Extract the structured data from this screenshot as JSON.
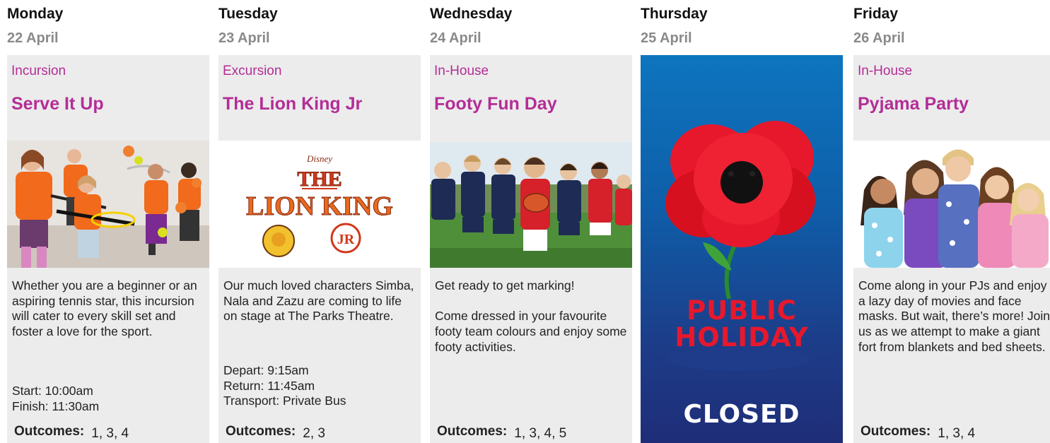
{
  "days": [
    {
      "day": "Monday",
      "date": "22 April",
      "type": "Incursion",
      "title": "Serve It Up",
      "image_icon": "tennis-kids-photo",
      "description": "Whether you are a beginner or an aspiring tennis star, this incursion will cater to every skill set and foster a love for the sport.",
      "times": "Start: 10:00am\nFinish: 11:30am",
      "outcomes_label": "Outcomes:",
      "outcomes": "1, 3, 4"
    },
    {
      "day": "Tuesday",
      "date": "23 April",
      "type": "Excursion",
      "title": "The Lion King Jr",
      "image_icon": "lion-king-jr-logo",
      "logo_text": {
        "brand": "Disney",
        "line1": "THE",
        "line2": "LION KING",
        "badge": "JR"
      },
      "description": "Our much loved characters Simba, Nala and Zazu are coming to life on stage at The Parks Theatre.",
      "times": "Depart: 9:15am\nReturn: 11:45am\nTransport: Private Bus",
      "outcomes_label": "Outcomes:",
      "outcomes": "2, 3"
    },
    {
      "day": "Wednesday",
      "date": "24 April",
      "type": "In-House",
      "title": "Footy Fun Day",
      "image_icon": "footy-kids-photo",
      "description": "Get ready to get marking!\n\nCome dressed in your favourite footy team colours and enjoy some footy activities.",
      "outcomes_label": "Outcomes:",
      "outcomes": "1, 3, 4, 5"
    },
    {
      "day": "Thursday",
      "date": "25 April",
      "holiday_line1": "PUBLIC",
      "holiday_line2": "HOLIDAY",
      "closed": "CLOSED",
      "image_icon": "poppy-icon"
    },
    {
      "day": "Friday",
      "date": "26 April",
      "type": "In-House",
      "title": "Pyjama Party",
      "image_icon": "pyjama-kids-photo",
      "description": "Come along in your PJs and enjoy a lazy day of movies and face masks. But wait, there’s more! Join us as we attempt to make a giant fort from blankets and bed sheets.",
      "outcomes_label": "Outcomes:",
      "outcomes": "1, 3, 4"
    }
  ],
  "colors": {
    "accent": "#b32d96",
    "date_grey": "#8a8a8a",
    "card_bg": "#ececec",
    "holiday_blue": "#0f5da8",
    "poppy_red": "#e8182c"
  }
}
